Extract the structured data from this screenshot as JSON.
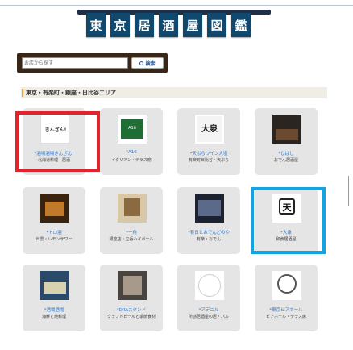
{
  "header": {
    "logo_chars": [
      "東",
      "京",
      "居",
      "酒",
      "屋",
      "図",
      "鑑"
    ]
  },
  "search": {
    "placeholder": "お店から探す",
    "button_label": "検索"
  },
  "area": {
    "title": "東京・有楽町・銀座・日比谷エリア"
  },
  "thumb_texts": {
    "kinzan": "きんざん!",
    "a16": "A16",
    "oizumi": "大泉",
    "ten": "天"
  },
  "restaurants": [
    {
      "name": "*酒場酒場きんざん!",
      "desc": "北海道料理・居酒"
    },
    {
      "name": "*A16",
      "desc": "イタリアン・テラス席"
    },
    {
      "name": "*天ぷらワイン大塩",
      "desc": "有楽町日比谷・天ぷら"
    },
    {
      "name": "*ひばし",
      "desc": "おでん居酒屋"
    },
    {
      "name": "*トロ酒",
      "desc": "出雲・レモンサワー"
    },
    {
      "name": "*一角",
      "desc": "銀座店・立呑ハイボール"
    },
    {
      "name": "*有日とおでんどのや",
      "desc": "有楽・おでん"
    },
    {
      "name": "*大衆",
      "desc": "和食居酒屋"
    },
    {
      "name": "*酒場酒場",
      "desc": "海鮮と焼料理"
    },
    {
      "name": "*DRAスタンド",
      "desc": "クラフトビールと季節食材"
    },
    {
      "name": "*アデニル",
      "desc": "所感居酒屋の居・バル"
    },
    {
      "name": "*東京ビアホール",
      "desc": "ビアホール・テラス席"
    }
  ]
}
